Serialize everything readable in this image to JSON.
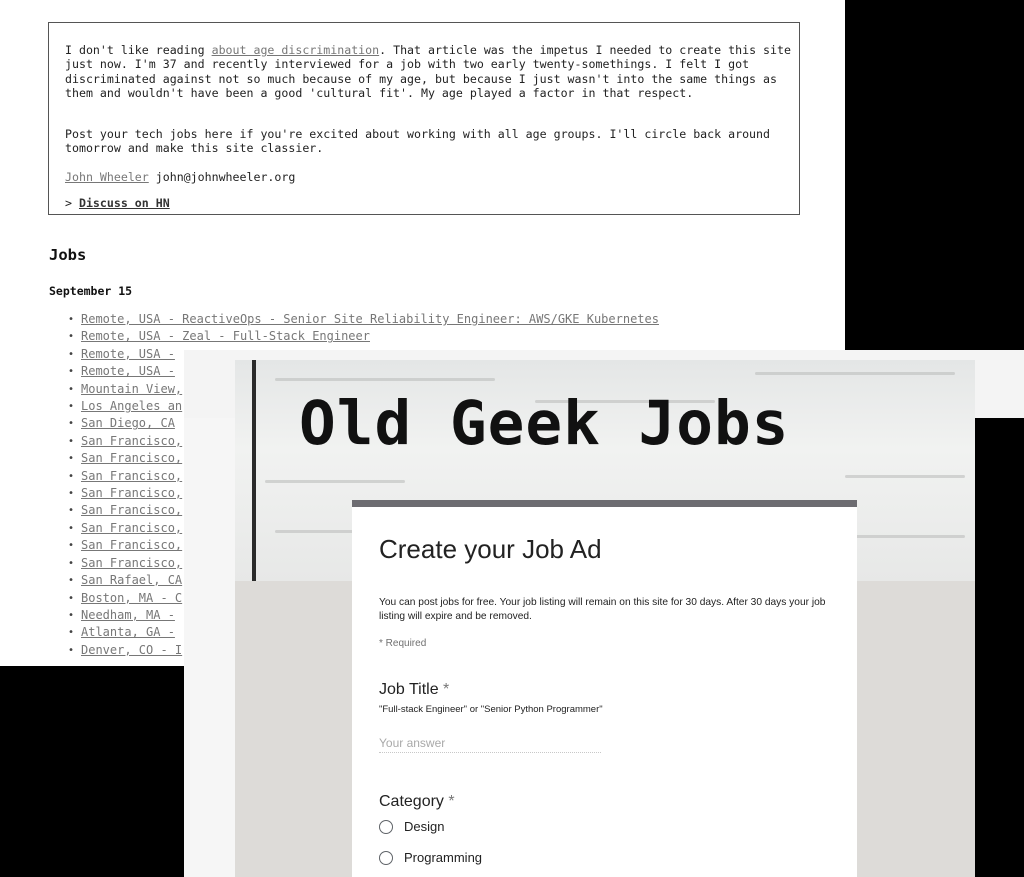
{
  "site": {
    "intro": {
      "p1_before": "I don't like reading ",
      "p1_link": "about age discrimination",
      "p1_after": ". That article was the impetus I needed to create this site just now. I'm 37 and recently interviewed for a job with two early twenty-somethings. I felt I got discriminated against not so much because of my age, but because I just wasn't into the same things as them and wouldn't have been a good 'cultural fit'. My age played a factor in that respect.",
      "p2": "Post your tech jobs here if you're excited about working with all age groups. I'll circle back around tomorrow and make this site classier.",
      "author_name": "John Wheeler",
      "author_email": "john@johnwheeler.org",
      "discuss_prefix": "> ",
      "discuss_link": "Discuss on HN"
    },
    "jobs_heading": "Jobs",
    "date_heading": "September 15",
    "jobs": [
      "Remote, USA - ReactiveOps - Senior Site Reliability Engineer: AWS/GKE Kubernetes",
      "Remote, USA - Zeal - Full-Stack Engineer",
      "Remote, USA -",
      "Remote, USA -",
      "Mountain View,",
      "Los Angeles an",
      "San Diego, CA",
      "San Francisco,",
      "San Francisco,",
      "San Francisco,",
      "San Francisco,",
      "San Francisco,",
      "San Francisco,",
      "San Francisco,",
      "San Francisco,",
      "San Rafael, CA",
      "Boston, MA - C",
      "Needham, MA -",
      "Atlanta, GA -",
      "Denver, CO - I"
    ]
  },
  "form": {
    "banner_title": "Old Geek Jobs",
    "title": "Create your Job Ad",
    "description": "You can post jobs for free. Your job listing will remain on this site for 30 days. After 30 days your job listing will expire and be removed.",
    "required_note": "* Required",
    "job_title": {
      "label": "Job Title",
      "star": "*",
      "help": "\"Full-stack Engineer\" or \"Senior Python Programmer\"",
      "placeholder": "Your answer",
      "value": ""
    },
    "category": {
      "label": "Category",
      "star": "*",
      "options": [
        "Design",
        "Programming"
      ]
    }
  }
}
